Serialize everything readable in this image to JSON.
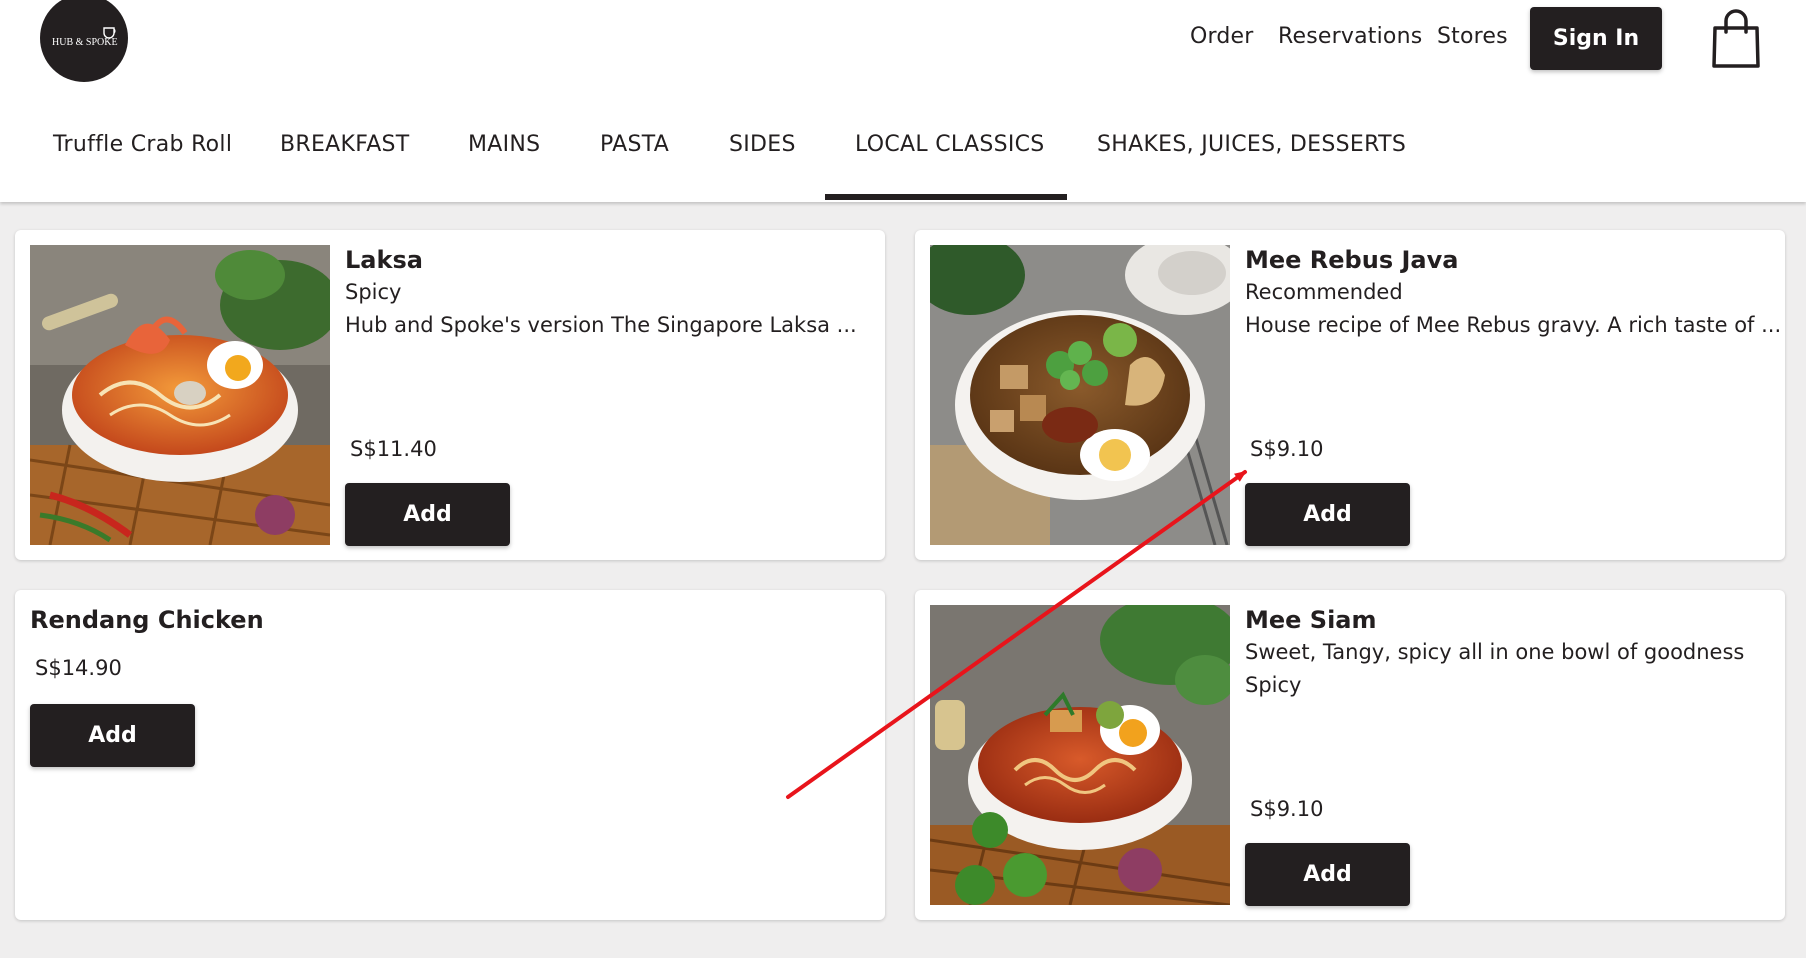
{
  "brand": {
    "logo_text": "HUB & SPOKE"
  },
  "top_nav": {
    "order": "Order",
    "reservations": "Reservations",
    "stores": "Stores",
    "sign_in": "Sign In"
  },
  "category_tabs": [
    {
      "label": "Truffle Crab Roll"
    },
    {
      "label": "BREAKFAST"
    },
    {
      "label": "MAINS"
    },
    {
      "label": "PASTA"
    },
    {
      "label": "SIDES"
    },
    {
      "label": "LOCAL CLASSICS",
      "active": true
    },
    {
      "label": "SHAKES, JUICES, DESSERTS"
    }
  ],
  "menu_items": [
    {
      "name": "Laksa",
      "tag": "Spicy",
      "description": "Hub and Spoke's version The Singapore Laksa ...",
      "price": "S$11.40",
      "add_label": "Add"
    },
    {
      "name": "Mee Rebus Java",
      "tag": "Recommended",
      "description": "House recipe of Mee Rebus gravy. A rich taste of ...",
      "price": "S$9.10",
      "add_label": "Add"
    },
    {
      "name": "Rendang Chicken",
      "price": "S$14.90",
      "add_label": "Add"
    },
    {
      "name": "Mee Siam",
      "description": "Sweet, Tangy, spicy all in one bowl of goodness",
      "tag": "Spicy",
      "price": "S$9.10",
      "add_label": "Add"
    }
  ],
  "colors": {
    "primary": "#231f20",
    "background": "#efeeee",
    "card": "#ffffff",
    "annotation_arrow": "#e8141b"
  }
}
